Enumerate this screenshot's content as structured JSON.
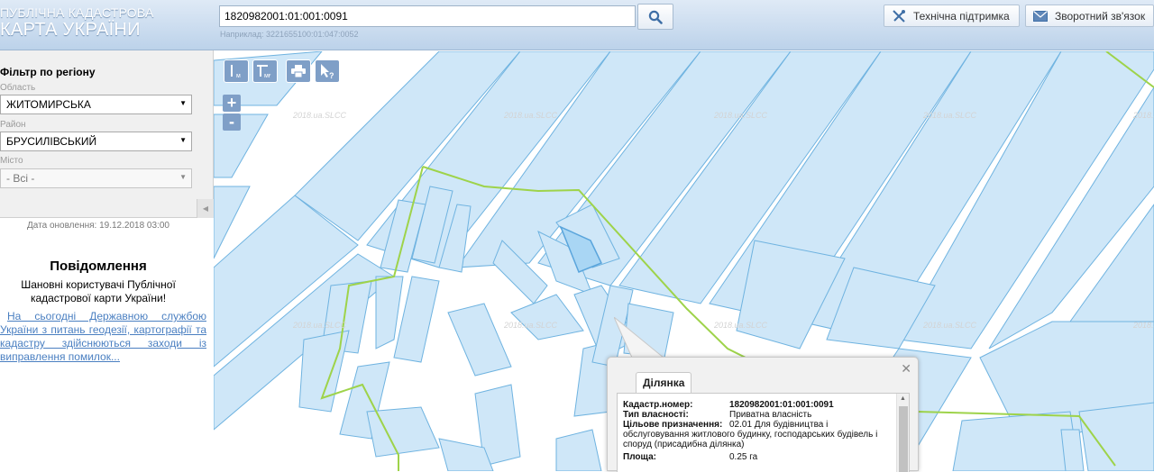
{
  "header": {
    "brand_line1": "ПУБЛІЧНА КАДАСТРОВА",
    "brand_line2": "КАРТА УКРАЇНИ",
    "search_value": "1820982001:01:001:0091",
    "search_hint": "Наприклад: 3221655100:01:047:0052",
    "support_label": "Технічна підтримка",
    "feedback_label": "Зворотний зв'язок"
  },
  "sidebar": {
    "filter_title": "Фільтр по регіону",
    "region_label": "Область",
    "region_value": "ЖИТОМИРСЬКА",
    "district_label": "Район",
    "district_value": "БРУСИЛІВСЬКИЙ",
    "city_label": "Місто",
    "city_value": "- Всі -",
    "update_date": "Дата оновлення: 19.12.2018 03:00",
    "news_title": "Повідомлення",
    "news_text": "Шановні користувачі Публічної кадастрової карти України!",
    "news_link": "На сьогодні Державною службою України з питань геодезії, картографії та кадастру здійснюються заходи із виправлення помилок..."
  },
  "map": {
    "watermark": "2018.ua.SLCC",
    "tool_m": "м",
    "tool_mf": "мғ",
    "zoom_in": "+",
    "zoom_out": "-"
  },
  "popup": {
    "tab_label": "Ділянка",
    "rows": [
      {
        "key": "Кадастр.номер:",
        "value": "1820982001:01:001:0091"
      },
      {
        "key": "Тип власності:",
        "value": "Приватна власність"
      },
      {
        "key": "Цільове призначення:",
        "value": "02.01 Для будівництва і обслуговування житлового будинку, господарських будівель і споруд (присадибна ділянка)"
      },
      {
        "key": "Площа:",
        "value": "0.25 га"
      }
    ]
  },
  "colors": {
    "parcel_fill": "#cfe7f8",
    "parcel_stroke": "#6fb3e0",
    "boundary": "#9ed34a",
    "tool_bg": "#7f9fc7"
  }
}
